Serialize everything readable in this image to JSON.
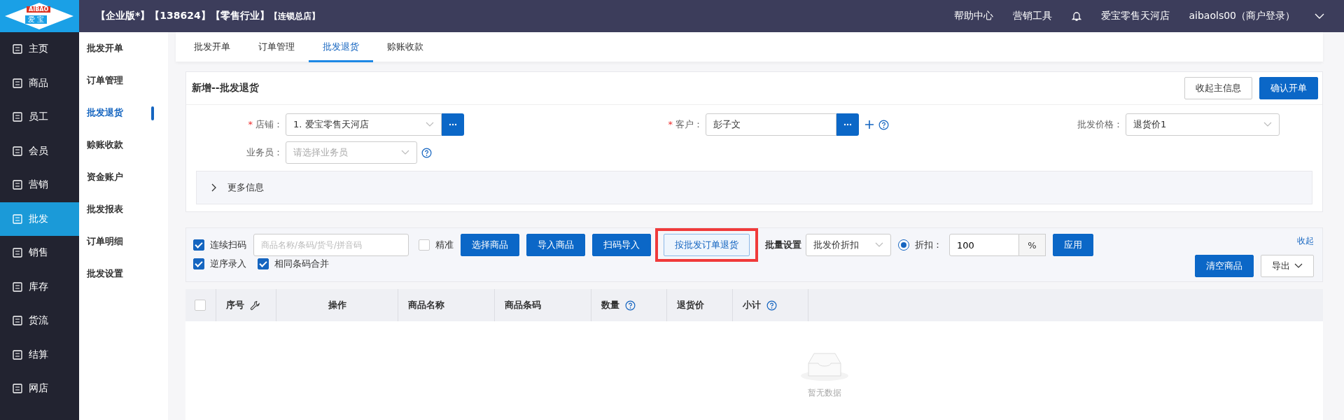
{
  "logo": {
    "word": "AIBAO",
    "name": "爱 宝"
  },
  "header": {
    "tags": [
      "【企业版*】",
      "【138624】",
      "【零售行业】",
      "【连锁总店】"
    ],
    "links": [
      "帮助中心",
      "营销工具"
    ],
    "store": "爱宝零售天河店",
    "user": "aibaols00（商户登录）"
  },
  "sidebar": {
    "items": [
      {
        "label": "主页",
        "selected": false
      },
      {
        "label": "商品",
        "selected": false
      },
      {
        "label": "员工",
        "selected": false
      },
      {
        "label": "会员",
        "selected": false
      },
      {
        "label": "营销",
        "selected": false
      },
      {
        "label": "批发",
        "selected": true
      },
      {
        "label": "销售",
        "selected": false
      },
      {
        "label": "库存",
        "selected": false
      },
      {
        "label": "货流",
        "selected": false
      },
      {
        "label": "结算",
        "selected": false
      },
      {
        "label": "网店",
        "selected": false
      }
    ]
  },
  "subnav": {
    "items": [
      {
        "label": "批发开单",
        "selected": false
      },
      {
        "label": "订单管理",
        "selected": false
      },
      {
        "label": "批发退货",
        "selected": true
      },
      {
        "label": "赊账收款",
        "selected": false
      },
      {
        "label": "资金账户",
        "selected": false
      },
      {
        "label": "批发报表",
        "selected": false
      },
      {
        "label": "订单明细",
        "selected": false
      },
      {
        "label": "批发设置",
        "selected": false
      }
    ]
  },
  "tabs": [
    {
      "label": "批发开单",
      "selected": false
    },
    {
      "label": "订单管理",
      "selected": false
    },
    {
      "label": "批发退货",
      "selected": true
    },
    {
      "label": "赊账收款",
      "selected": false
    }
  ],
  "form": {
    "title": "新增--批发退货",
    "buttons": [
      {
        "label": "收起主信息",
        "kind": "default"
      },
      {
        "label": "确认开单",
        "kind": "primary"
      }
    ],
    "fields": [
      {
        "required_mark": "*",
        "label": "店铺：",
        "value": "1. 爱宝零售天河店",
        "kind": "picker"
      },
      {
        "required_mark": "*",
        "label": "客户：",
        "value": "彭子文",
        "kind": "customer"
      },
      {
        "label": "批发价格：",
        "value": "退货价1",
        "kind": "select"
      },
      {
        "label": "业务员：",
        "placeholder": "请选择业务员",
        "kind": "select-help"
      }
    ],
    "more_info": {
      "label": "更多信息",
      "expanded": false
    }
  },
  "toolbar": {
    "scan": {
      "label": "连续扫码",
      "checked": true
    },
    "search": {
      "placeholder": "商品名称/条码/货号/拼音码"
    },
    "exact": {
      "label": "精准",
      "checked": false
    },
    "buttons": [
      {
        "label": "选择商品",
        "kind": "primary",
        "highlighted": false
      },
      {
        "label": "导入商品",
        "kind": "primary",
        "highlighted": false
      },
      {
        "label": "扫码导入",
        "kind": "primary",
        "highlighted": false
      },
      {
        "label": "按批发订单退货",
        "kind": "outline",
        "highlighted": true
      }
    ],
    "batch_label": "批量设置",
    "batch_select": "批发价折扣",
    "discount": {
      "label": "折扣：",
      "checked": true,
      "value": "100",
      "unit": "%"
    },
    "apply": "应用",
    "collapse": "收起",
    "options": [
      {
        "label": "逆序录入",
        "checked": true
      },
      {
        "label": "相同条码合并",
        "checked": true
      }
    ],
    "clear": "清空商品",
    "export": "导出"
  },
  "table": {
    "select_all": {
      "checked": false
    },
    "columns": [
      {
        "label": "序号",
        "kind": "wrench"
      },
      {
        "label": "操作",
        "kind": "plain"
      },
      {
        "label": "商品名称",
        "kind": "plain"
      },
      {
        "label": "商品条码",
        "kind": "plain"
      },
      {
        "label": "数量",
        "kind": "help"
      },
      {
        "label": "退货价",
        "kind": "plain"
      },
      {
        "label": "小计",
        "kind": "help"
      }
    ],
    "empty": "暂无数据"
  }
}
